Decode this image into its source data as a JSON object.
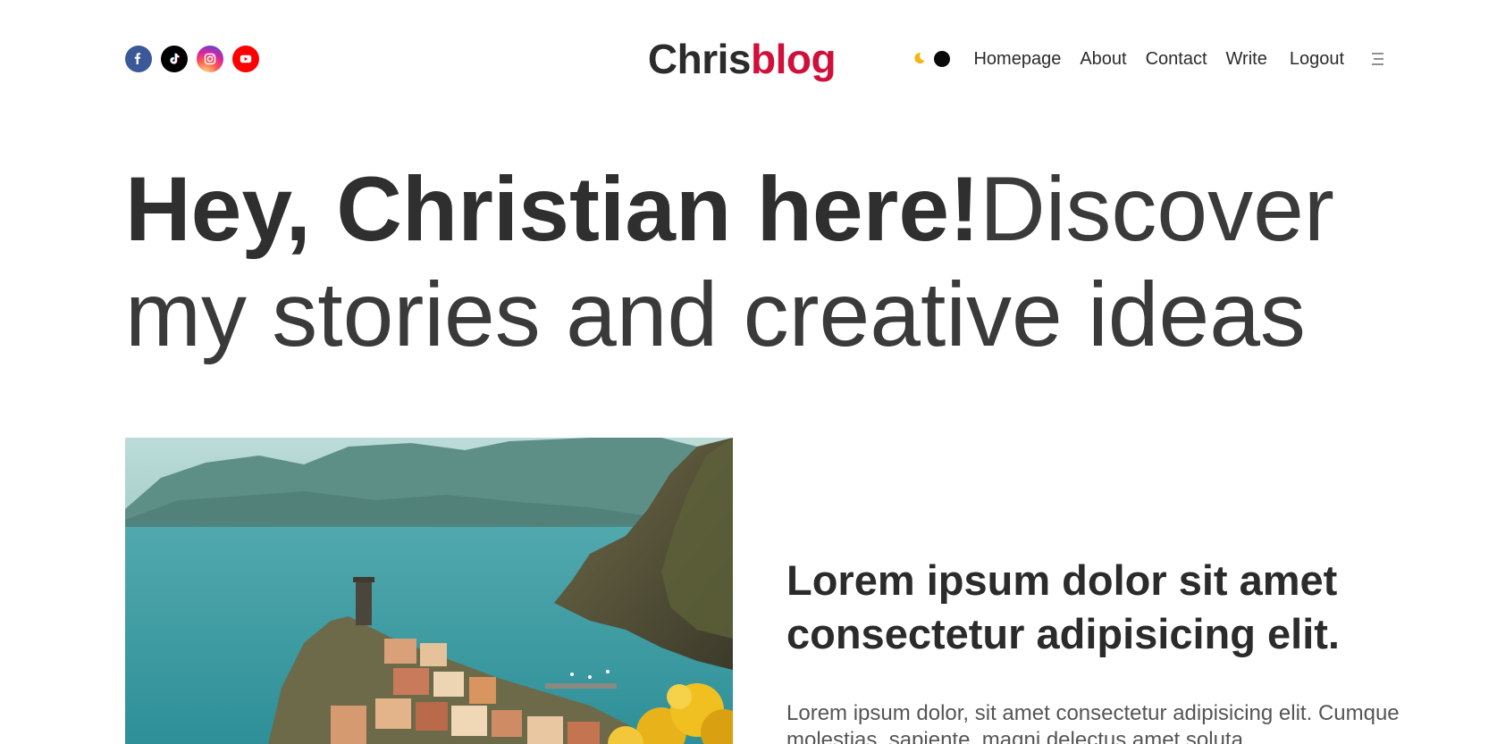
{
  "header": {
    "socials": [
      {
        "name": "facebook-icon"
      },
      {
        "name": "tiktok-icon"
      },
      {
        "name": "instagram-icon"
      },
      {
        "name": "youtube-icon"
      }
    ],
    "logo": {
      "part1": "Chris",
      "part2": "blog"
    },
    "theme_toggle": {
      "icon": "moon-icon",
      "state": "dark"
    },
    "nav": {
      "homepage": "Homepage",
      "about": "About",
      "contact": "Contact",
      "write": "Write",
      "logout": "Logout"
    },
    "menu_icon": "menu-icon"
  },
  "hero": {
    "bold": "Hey, Christian here!",
    "light": "Discover my stories and creative ideas"
  },
  "featured": {
    "image": "cinque-terre-coastal-village",
    "title": "Lorem ipsum dolor sit amet consectetur adipisicing elit.",
    "excerpt": "Lorem ipsum dolor, sit amet consectetur adipisicing elit. Cumque molestias, sapiente, magni delectus amet soluta"
  },
  "colors": {
    "brand_red": "#d0103a",
    "text": "#2b2b2b",
    "facebook": "#3b5998",
    "youtube": "#ff0000"
  }
}
